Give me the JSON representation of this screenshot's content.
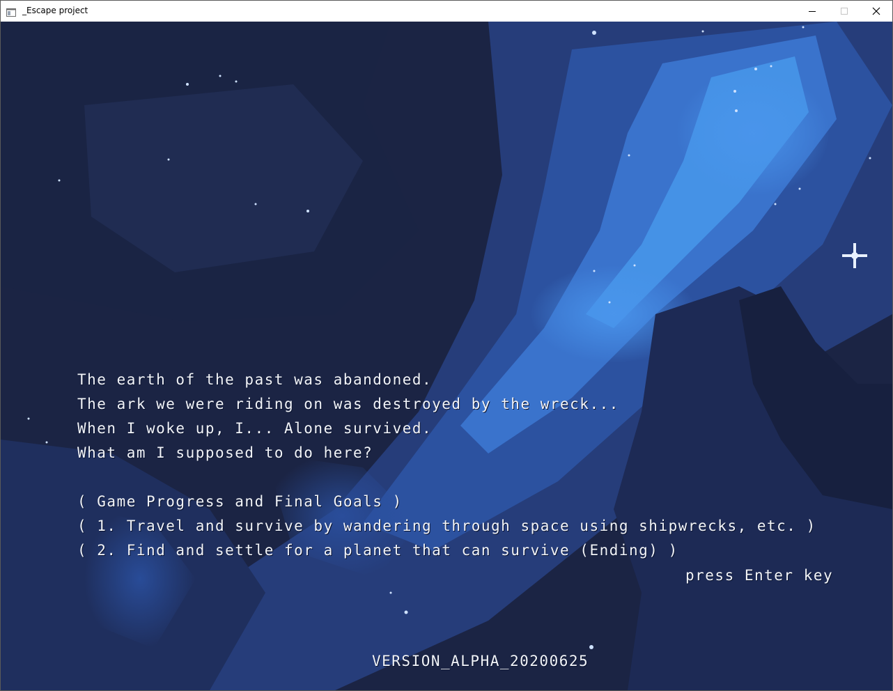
{
  "window": {
    "title": "_Escape project"
  },
  "icons": {
    "app": "app-window-icon",
    "minimize": "minimize-icon",
    "maximize": "maximize-icon",
    "close": "close-icon"
  },
  "colors": {
    "background_dark": "#1a2340",
    "nebula_mid": "#2c4f9a",
    "nebula_light": "#3f86e0",
    "text": "#f2f4f8"
  },
  "intro": {
    "lines": [
      "The earth of the past was abandoned.",
      "The ark we were riding on was destroyed by the wreck...",
      "When I woke up, I... Alone survived.",
      "What am I supposed to do here?",
      "",
      "( Game Progress and Final Goals )",
      "( 1. Travel and survive by wandering through space using shipwrecks, etc. )",
      "( 2. Find and settle for a planet that can survive (Ending) )"
    ],
    "prompt": "press Enter key"
  },
  "version": "VERSION_ALPHA_20200625"
}
